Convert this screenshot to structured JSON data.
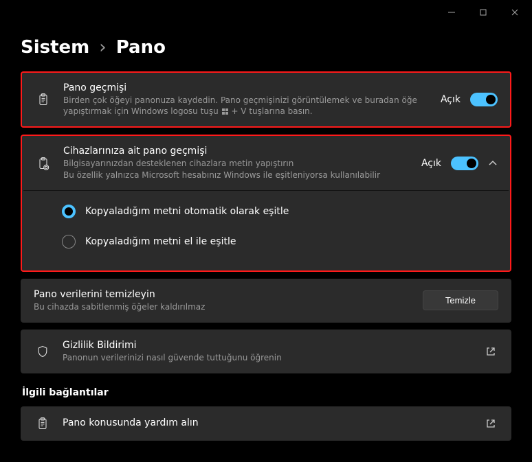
{
  "breadcrumb": {
    "parent": "Sistem",
    "current": "Pano"
  },
  "history": {
    "title": "Pano geçmişi",
    "desc_before": "Birden çok öğeyi panonuza kaydedin. Pano geçmişinizi görüntülemek ve buradan öğe yapıştırmak için Windows logosu tuşu",
    "desc_after": "+ V tuşlarına basın.",
    "state": "Açık"
  },
  "devices": {
    "title": "Cihazlarınıza ait pano geçmişi",
    "desc": "Bilgisayarınızdan desteklenen cihazlara metin yapıştırın",
    "subdesc": "Bu özellik yalnızca Microsoft hesabınız Windows ile eşitleniyorsa kullanılabilir",
    "state": "Açık",
    "options": {
      "auto": "Kopyaladığım metni otomatik olarak eşitle",
      "manual": "Kopyaladığım metni el ile eşitle"
    }
  },
  "clear": {
    "title": "Pano verilerini temizleyin",
    "desc": "Bu cihazda sabitlenmiş öğeler kaldırılmaz",
    "button": "Temizle"
  },
  "privacy": {
    "title": "Gizlilik Bildirimi",
    "desc": "Panonun verilerinizi nasıl güvende tuttuğunu öğrenin"
  },
  "related": {
    "heading": "İlgili bağlantılar",
    "help": "Pano konusunda yardım alın"
  }
}
